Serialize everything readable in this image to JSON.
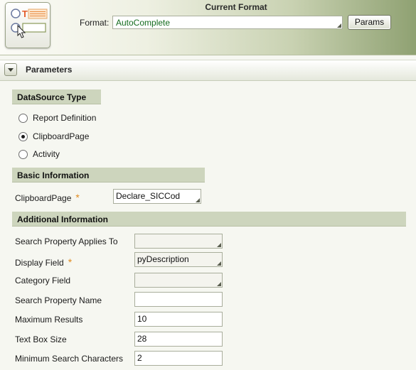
{
  "header": {
    "title": "Current Format",
    "format_label": "Format:",
    "format_value": "AutoComplete",
    "params_label": "Params"
  },
  "parameters_bar": {
    "title": "Parameters"
  },
  "datasource": {
    "title": "DataSource Type",
    "options": [
      {
        "label": "Report Definition",
        "checked": false
      },
      {
        "label": "ClipboardPage",
        "checked": true
      },
      {
        "label": "Activity",
        "checked": false
      }
    ]
  },
  "basic": {
    "title": "Basic Information",
    "clipboard_label": "ClipboardPage",
    "clipboard_value": "Declare_SICCod"
  },
  "additional": {
    "title": "Additional Information",
    "fields": [
      {
        "label": "Search Property Applies To",
        "value": "",
        "required": false
      },
      {
        "label": "Display Field",
        "value": "pyDescription",
        "required": true
      },
      {
        "label": "Category Field",
        "value": "",
        "required": false
      },
      {
        "label": "Search Property Name",
        "value": "",
        "required": false
      },
      {
        "label": "Maximum Results",
        "value": "10",
        "required": false
      },
      {
        "label": "Text Box Size",
        "value": "28",
        "required": false
      },
      {
        "label": "Minimum Search Characters",
        "value": "2",
        "required": false
      }
    ]
  },
  "required_marker": "*",
  "colors": {
    "section_header": "#cdd5bd",
    "required_star": "#e08a1e",
    "format_value_text": "#136b1d"
  }
}
